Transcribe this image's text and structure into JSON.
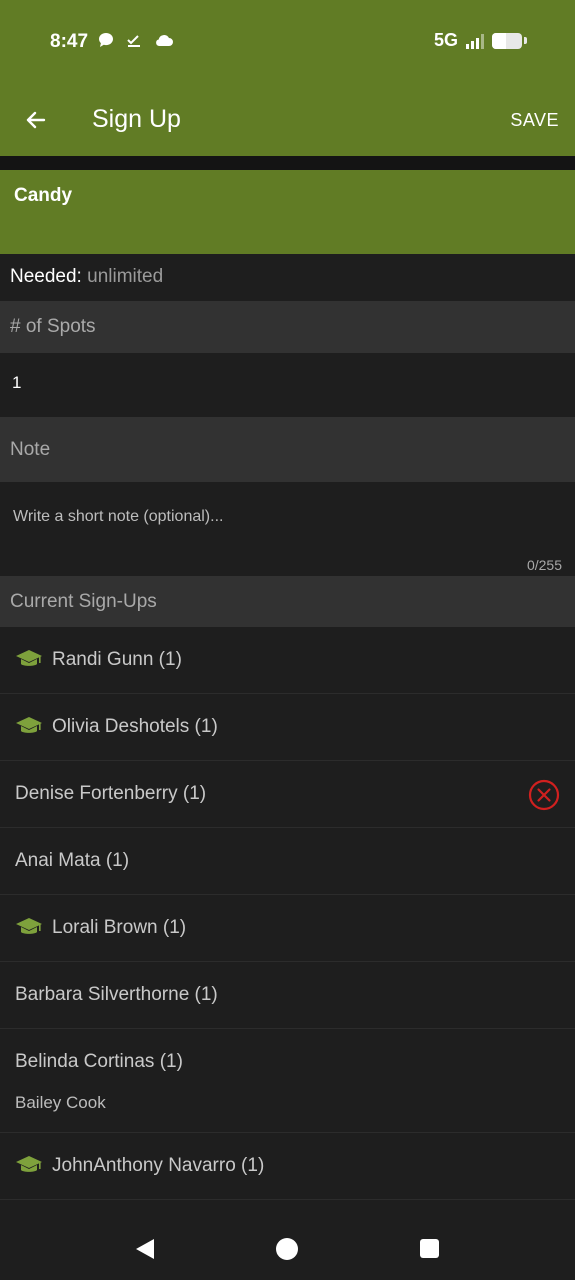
{
  "status": {
    "time": "8:47",
    "network": "5G"
  },
  "appbar": {
    "title": "Sign Up",
    "save_label": "SAVE",
    "back_icon": "arrow-left-icon"
  },
  "item": {
    "title": "Candy"
  },
  "needed": {
    "label": "Needed:",
    "value": "unlimited"
  },
  "spots": {
    "header": "# of Spots",
    "value": "1"
  },
  "note": {
    "header": "Note",
    "placeholder": "Write a short note (optional)...",
    "count": "0/255"
  },
  "signups": {
    "header": "Current Sign-Ups",
    "rows": [
      {
        "name": "Randi Gunn (1)",
        "icon": "graduation-cap-icon"
      },
      {
        "name": "Olivia Deshotels (1)",
        "icon": "graduation-cap-icon"
      },
      {
        "name": "Denise Fortenberry (1)",
        "action_icon": "remove-circle-icon"
      },
      {
        "name": "Anai Mata (1)"
      },
      {
        "name": "Lorali Brown (1)",
        "icon": "graduation-cap-icon"
      },
      {
        "name": "Barbara Silverthorne (1)"
      },
      {
        "name": "Belinda Cortinas (1)",
        "subtext": "Bailey Cook"
      },
      {
        "name": "JohnAnthony Navarro (1)",
        "icon": "graduation-cap-icon"
      }
    ]
  },
  "colors": {
    "brand_green": "#617c25",
    "icon_green": "#7ea13c",
    "remove_red": "#d0201f"
  }
}
